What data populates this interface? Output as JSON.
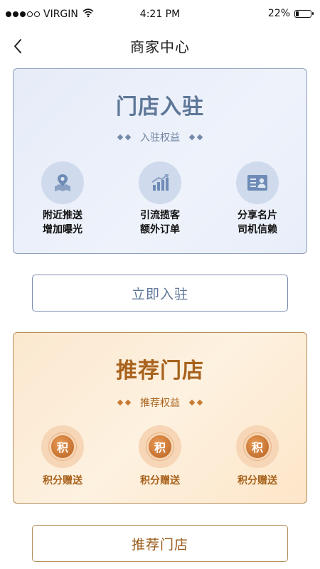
{
  "status_bar": {
    "carrier": "VIRGIN",
    "time": "4:21 PM",
    "battery_text": "22%",
    "battery_level": 0.22
  },
  "nav": {
    "title": "商家中心",
    "back_icon": "chevron-left-icon"
  },
  "join_card": {
    "title": "门店入驻",
    "subtitle": "入驻权益",
    "features": [
      {
        "icon": "location-pin-icon",
        "line1": "附近推送",
        "line2": "增加曝光"
      },
      {
        "icon": "bar-chart-icon",
        "line1": "引流揽客",
        "line2": "额外订单"
      },
      {
        "icon": "business-card-icon",
        "line1": "分享名片",
        "line2": "司机信赖"
      }
    ],
    "button_label": "立即入驻"
  },
  "recommend_card": {
    "title": "推荐门店",
    "subtitle": "推荐权益",
    "features": [
      {
        "icon": "points-coin-icon",
        "coin_char": "积",
        "label": "积分赠送"
      },
      {
        "icon": "points-coin-icon",
        "coin_char": "积",
        "label": "积分赠送"
      },
      {
        "icon": "points-coin-icon",
        "coin_char": "积",
        "label": "积分赠送"
      }
    ],
    "button_label": "推荐门店"
  },
  "colors": {
    "blue_accent": "#5e7797",
    "gold_accent": "#a8621c"
  }
}
